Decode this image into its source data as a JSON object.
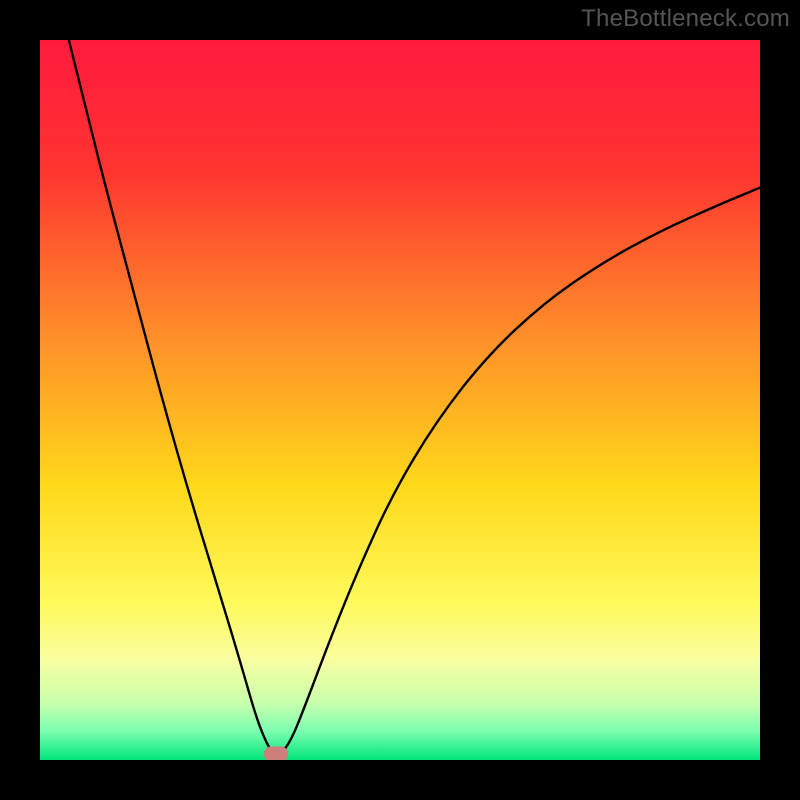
{
  "watermark": "TheBottleneck.com",
  "chart_data": {
    "type": "line",
    "title": "",
    "xlabel": "",
    "ylabel": "",
    "xlim": [
      0,
      100
    ],
    "ylim": [
      0,
      100
    ],
    "grid": false,
    "legend": false,
    "gradient_stops": [
      {
        "pct": 0,
        "color": "#ff1a3d"
      },
      {
        "pct": 18,
        "color": "#ff3430"
      },
      {
        "pct": 40,
        "color": "#ff8a2a"
      },
      {
        "pct": 62,
        "color": "#ffd91a"
      },
      {
        "pct": 78,
        "color": "#fff95a"
      },
      {
        "pct": 86,
        "color": "#f9ffa0"
      },
      {
        "pct": 92,
        "color": "#caffad"
      },
      {
        "pct": 96,
        "color": "#7cffb0"
      },
      {
        "pct": 100,
        "color": "#00e57a"
      }
    ],
    "series": [
      {
        "name": "bottleneck-curve",
        "stroke": "#000000",
        "stroke_width": 2.4,
        "points": [
          {
            "x": 4,
            "y": 100
          },
          {
            "x": 6,
            "y": 92
          },
          {
            "x": 9,
            "y": 80
          },
          {
            "x": 13,
            "y": 65
          },
          {
            "x": 17,
            "y": 50
          },
          {
            "x": 21,
            "y": 36
          },
          {
            "x": 25,
            "y": 23
          },
          {
            "x": 28,
            "y": 13
          },
          {
            "x": 30,
            "y": 6
          },
          {
            "x": 31.5,
            "y": 2.2
          },
          {
            "x": 32.5,
            "y": 0.8
          },
          {
            "x": 33.5,
            "y": 0.8
          },
          {
            "x": 35,
            "y": 3
          },
          {
            "x": 37,
            "y": 8
          },
          {
            "x": 40,
            "y": 16
          },
          {
            "x": 44,
            "y": 26
          },
          {
            "x": 49,
            "y": 37
          },
          {
            "x": 55,
            "y": 47
          },
          {
            "x": 62,
            "y": 56
          },
          {
            "x": 70,
            "y": 63.5
          },
          {
            "x": 78,
            "y": 69
          },
          {
            "x": 86,
            "y": 73.4
          },
          {
            "x": 94,
            "y": 77
          },
          {
            "x": 100,
            "y": 79.5
          }
        ]
      }
    ],
    "marker": {
      "x": 32.8,
      "y": 0.9,
      "color": "#cd7f7b"
    }
  }
}
